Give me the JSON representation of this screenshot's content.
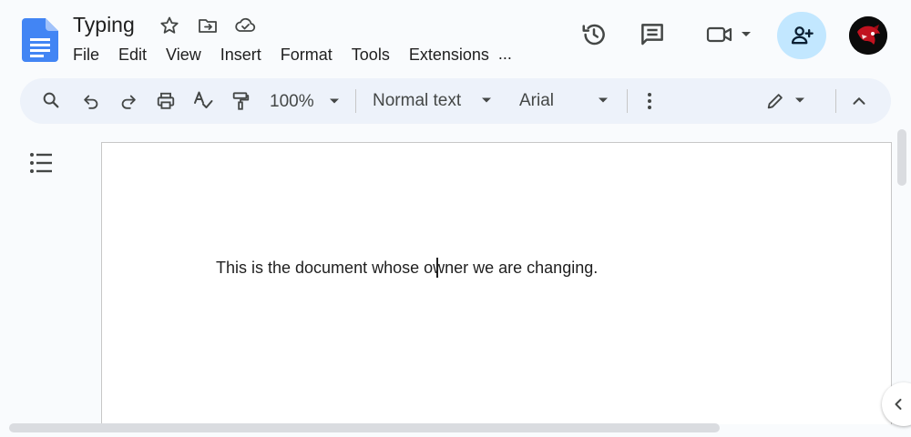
{
  "header": {
    "title": "Typing",
    "icons": [
      "star-icon",
      "move-to-folder-icon",
      "cloud-saved-icon"
    ],
    "right_icons": [
      "version-history-icon",
      "comments-icon",
      "meet-video-icon",
      "share-add-person-icon"
    ]
  },
  "menu": {
    "items": [
      "File",
      "Edit",
      "View",
      "Insert",
      "Format",
      "Tools",
      "Extensions"
    ],
    "more": "..."
  },
  "toolbar": {
    "zoom": "100%",
    "style": "Normal text",
    "font": "Arial"
  },
  "document": {
    "text": "This is the document whose owner we are changing."
  },
  "colors": {
    "accent_blue": "#4285f4",
    "share_bg": "#c2e7ff",
    "toolbar_bg": "#edf2fa",
    "page_bg": "#f9fbfd"
  }
}
